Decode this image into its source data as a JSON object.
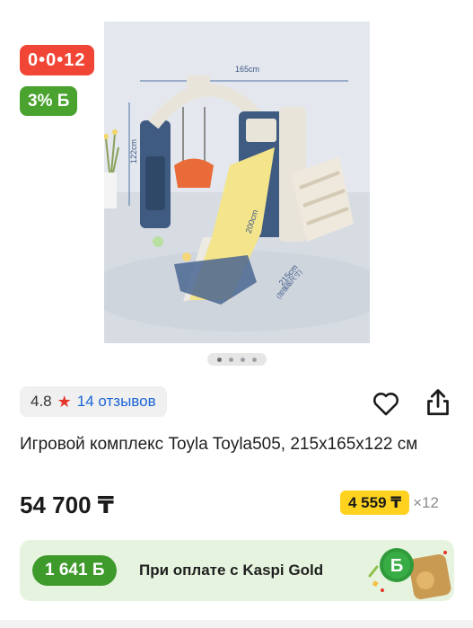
{
  "gallery": {
    "timer": "0•0•12",
    "bonus_badge": "3% Б",
    "photo": {
      "width_label": "165cm",
      "height_label": "122cm",
      "slide_label": "200cm",
      "depth_label": "215cm",
      "depth_sub": "(加强版尺寸)"
    },
    "slides_total": 4,
    "slide_active": 1
  },
  "rating": {
    "score": "4.8",
    "star": "★",
    "reviews": "14 отзывов"
  },
  "product": {
    "title": "Игровой комплекс Toyla Toyla505, 215x165x122 см",
    "price": "54 700 ₸"
  },
  "installment": {
    "amount": "4 559 ₸",
    "multiplier": "×12"
  },
  "kaspi_gold": {
    "bonus": "1 641 Б",
    "text": "При оплате с Kaspi Gold",
    "coin_glyph": "Б"
  },
  "colors": {
    "timer_bg": "#f14635",
    "bonus_bg": "#4aa22f",
    "star": "#e5352b",
    "link": "#1a64d6",
    "installment_bg": "#ffd21f",
    "banner_bg": "#e6f4df",
    "banner_pill": "#3f9a2c"
  }
}
